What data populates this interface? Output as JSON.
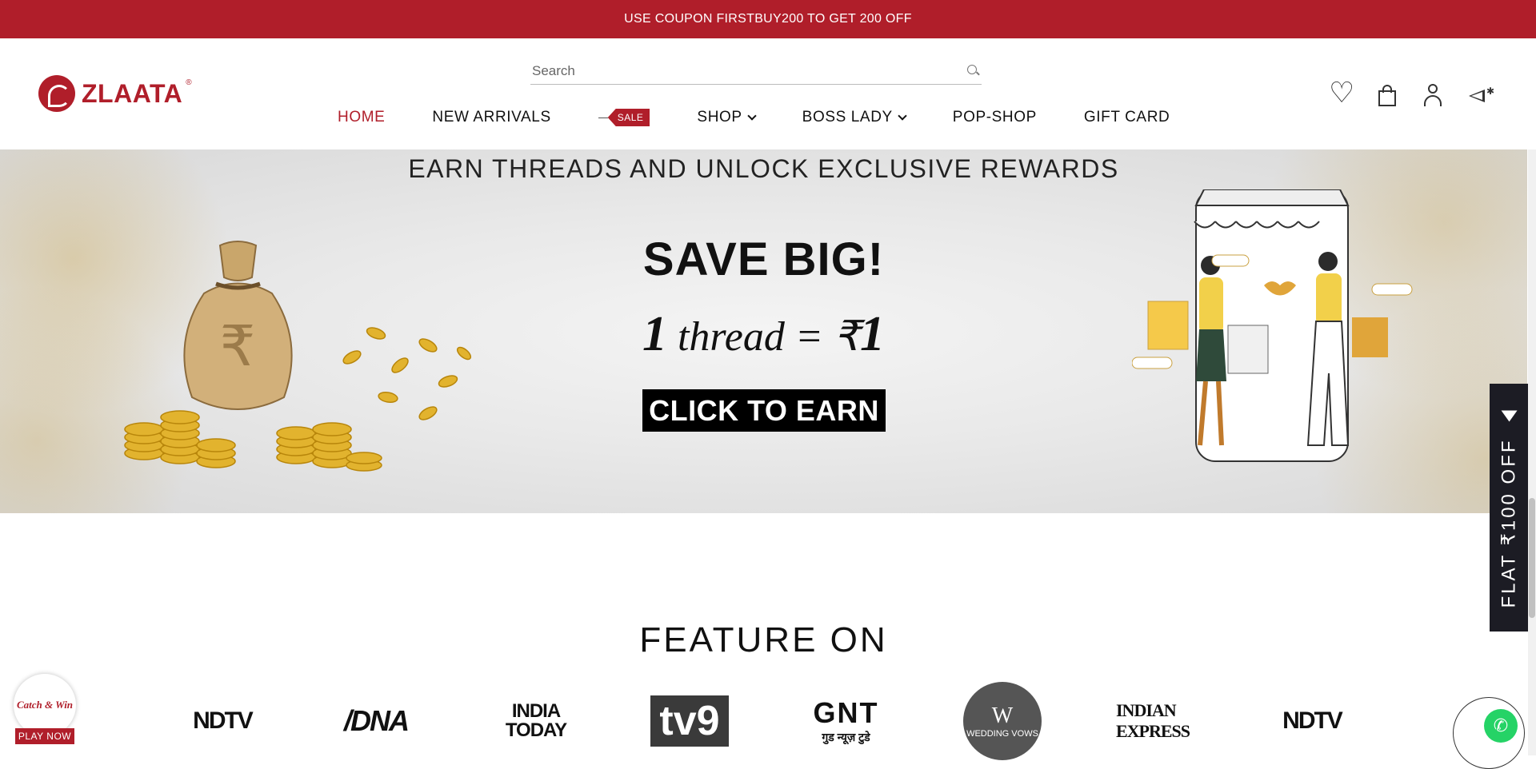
{
  "announcement": "USE COUPON FIRSTBUY200 TO GET 200 OFF",
  "brand": {
    "name": "ZLAATA",
    "reg": "®",
    "color": "#b01e2a"
  },
  "search": {
    "placeholder": "Search"
  },
  "nav": {
    "home": "HOME",
    "new_arrivals": "NEW ARRIVALS",
    "sale": "SALE",
    "shop": "SHOP",
    "boss_lady": "BOSS LADY",
    "pop_shop": "POP-SHOP",
    "gift_card": "GIFT CARD"
  },
  "header_icons": [
    "heart-icon",
    "bag-icon",
    "user-icon",
    "megaphone-icon"
  ],
  "banner": {
    "heading": "EARN THREADS AND UNLOCK EXCLUSIVE REWARDS",
    "title": "SAVE BIG!",
    "eq_left_num": "1",
    "eq_left_word": "thread =",
    "eq_currency": "₹",
    "eq_right_num": "1",
    "cta": "CLICK TO EARN",
    "rupee_symbol": "₹"
  },
  "side_tab": {
    "label": "FLAT ₹100 OFF"
  },
  "feature": {
    "title": "FEATURE ON",
    "logos": {
      "ndtv": "NDTV",
      "dna": "/DNA",
      "india_today_1": "INDIA",
      "india_today_2": "TODAY",
      "tv9": "tv9",
      "gnt": "GNT",
      "gnt_sub": "गुड न्यूज़ टुडे",
      "wedding_vows_mark": "W",
      "wedding_vows": "WEDDING VOWS",
      "indian_express": "INDIAN EXPRESS",
      "ndtv_2": "NDTV"
    }
  },
  "catch_win": {
    "label": "Catch & Win",
    "button": "PLAY NOW"
  },
  "colors": {
    "accent": "#b01e2a",
    "dark_tab": "#1c1c24",
    "whatsapp": "#25d366"
  }
}
